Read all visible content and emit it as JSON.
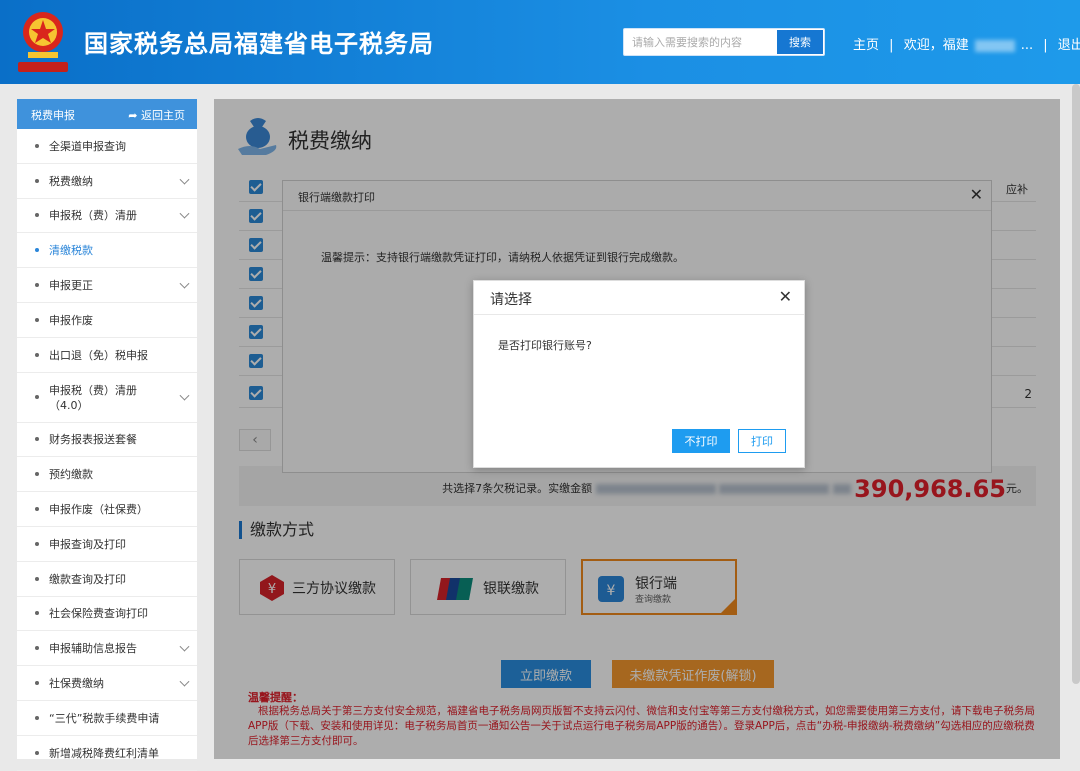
{
  "header": {
    "title": "国家税务总局福建省电子税务局",
    "search_placeholder": "请输入需要搜索的内容",
    "search_button": "搜索",
    "nav_home": "主页",
    "nav_welcome": "欢迎，福建",
    "nav_ellipsis": "...",
    "nav_logout": "退出"
  },
  "sidebar": {
    "title": "税费申报",
    "back": "返回主页",
    "items": [
      {
        "label": "全渠道申报查询"
      },
      {
        "label": "税费缴纳"
      },
      {
        "label": "申报税（费）清册"
      },
      {
        "label": "清缴税款"
      },
      {
        "label": "申报更正"
      },
      {
        "label": "申报作废"
      },
      {
        "label": "出口退（免）税申报"
      },
      {
        "label": "申报税（费）清册（4.0）"
      },
      {
        "label": "财务报表报送套餐"
      },
      {
        "label": "预约缴款"
      },
      {
        "label": "申报作废（社保费）"
      },
      {
        "label": "申报查询及打印"
      },
      {
        "label": "缴款查询及打印"
      },
      {
        "label": "社会保险费查询打印"
      },
      {
        "label": "申报辅助信息报告"
      },
      {
        "label": "社保费缴纳"
      },
      {
        "label": "“三代”税款手续费申请"
      },
      {
        "label": "新增减税降费红利清单"
      }
    ]
  },
  "main": {
    "title": "税费缴纳",
    "table_col_partial": "应补",
    "cell_partial": "2",
    "summary_text": "共选择7条欠税记录。实缴金额",
    "summary_amount": "390,968.65",
    "summary_unit": "元。",
    "pay_method_title": "缴款方式",
    "pay_cards": {
      "agreement": "三方协议缴款",
      "unionpay": "银联缴款",
      "bank": "银行端",
      "bank_sub": "查询缴款"
    },
    "btn_pay": "立即缴款",
    "btn_unpaid": "未缴款凭证作废(解锁)",
    "notice_title": "温馨提醒：",
    "notice_body": "根据税务总局关于第三方支付安全规范，福建省电子税务局网页版暂不支持云闪付、微信和支付宝等第三方支付缴税方式，如您需要使用第三方支付，请下载电子税务局APP版（下载、安装和使用详见：电子税务局首页一通知公告一关于试点运行电子税务局APP版的通告）。登录APP后，点击“办税-申报缴纳-税费缴纳”勾选相应的应缴税费后选择第三方支付即可。"
  },
  "dialog_bank": {
    "title": "银行端缴款打印",
    "tip": "温馨提示：支持银行端缴款凭证打印，请纳税人依据凭证到银行完成缴款。"
  },
  "dialog_choose": {
    "title": "请选择",
    "question": "是否打印银行账号?",
    "btn_no": "不打印",
    "btn_yes": "打印"
  },
  "colors": {
    "header_blue": "#1b8fe4",
    "accent_orange": "#f08a1c",
    "warn_red": "#e0202b"
  }
}
